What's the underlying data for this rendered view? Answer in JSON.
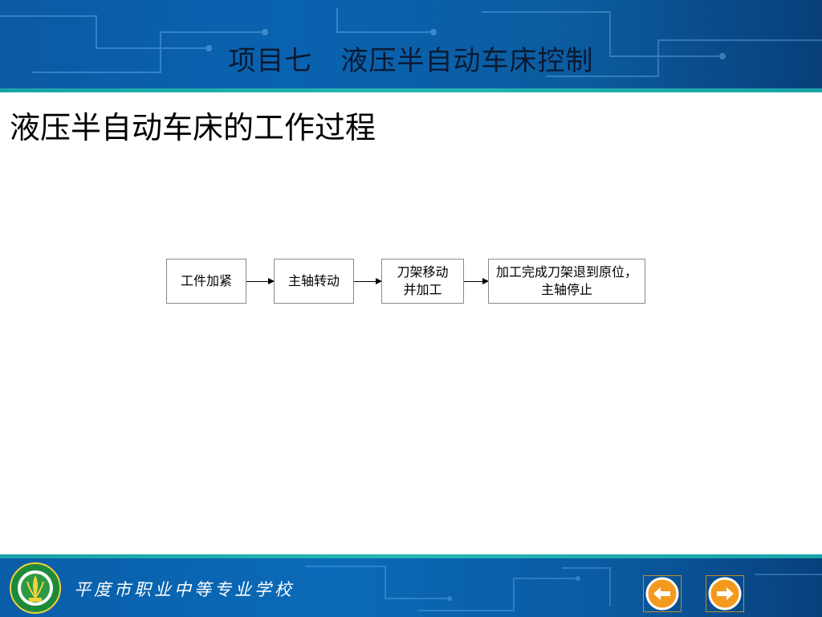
{
  "header": {
    "title": "项目七　液压半自动车床控制"
  },
  "page": {
    "heading": "液压半自动车床的工作过程"
  },
  "flowchart": {
    "steps": [
      {
        "label": "工件加紧"
      },
      {
        "label": "主轴转动"
      },
      {
        "label": "刀架移动并加工"
      },
      {
        "label": "加工完成刀架退到原位，主轴停止"
      }
    ]
  },
  "footer": {
    "school_name": "平度市职业中等专业学校",
    "logo_icon": "school-emblem-icon",
    "prev_icon": "arrow-left-icon",
    "next_icon": "arrow-right-icon",
    "accent_color": "#f39a1e"
  }
}
